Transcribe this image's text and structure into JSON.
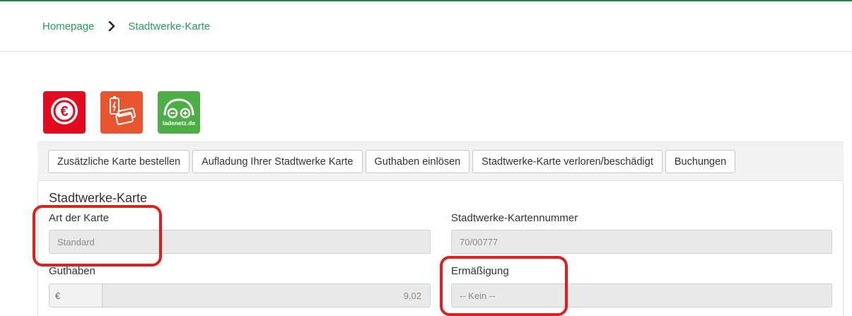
{
  "breadcrumb": {
    "home": "Homepage",
    "current": "Stadtwerke-Karte"
  },
  "tiles": [
    {
      "name": "euro",
      "icon": "euro-icon",
      "color": "#e30b1e"
    },
    {
      "name": "charging-card",
      "icon": "charging-card-icon",
      "color": "#e8542d"
    },
    {
      "name": "ladenetz",
      "icon": "ladenetz-car-icon",
      "color": "#4cae45",
      "logo_text": "ladenetz.de"
    }
  ],
  "toolbar": {
    "buttons": [
      "Zusätzliche Karte bestellen",
      "Aufladung Ihrer Stadtwerke Karte",
      "Guthaben einlösen",
      "Stadtwerke-Karte verloren/beschädigt",
      "Buchungen"
    ]
  },
  "panel": {
    "title": "Stadtwerke-Karte",
    "card_type": {
      "label": "Art der Karte",
      "value": "Standard"
    },
    "card_number": {
      "label": "Stadtwerke-Kartennummer",
      "value": "70/00777"
    },
    "balance": {
      "label": "Guthaben",
      "currency": "€",
      "value": "9,02"
    },
    "discount": {
      "label": "Ermäßigung",
      "value": "-- Kein --"
    }
  },
  "colors": {
    "link": "#2b9a5e",
    "highlight": "#e01e1e"
  }
}
